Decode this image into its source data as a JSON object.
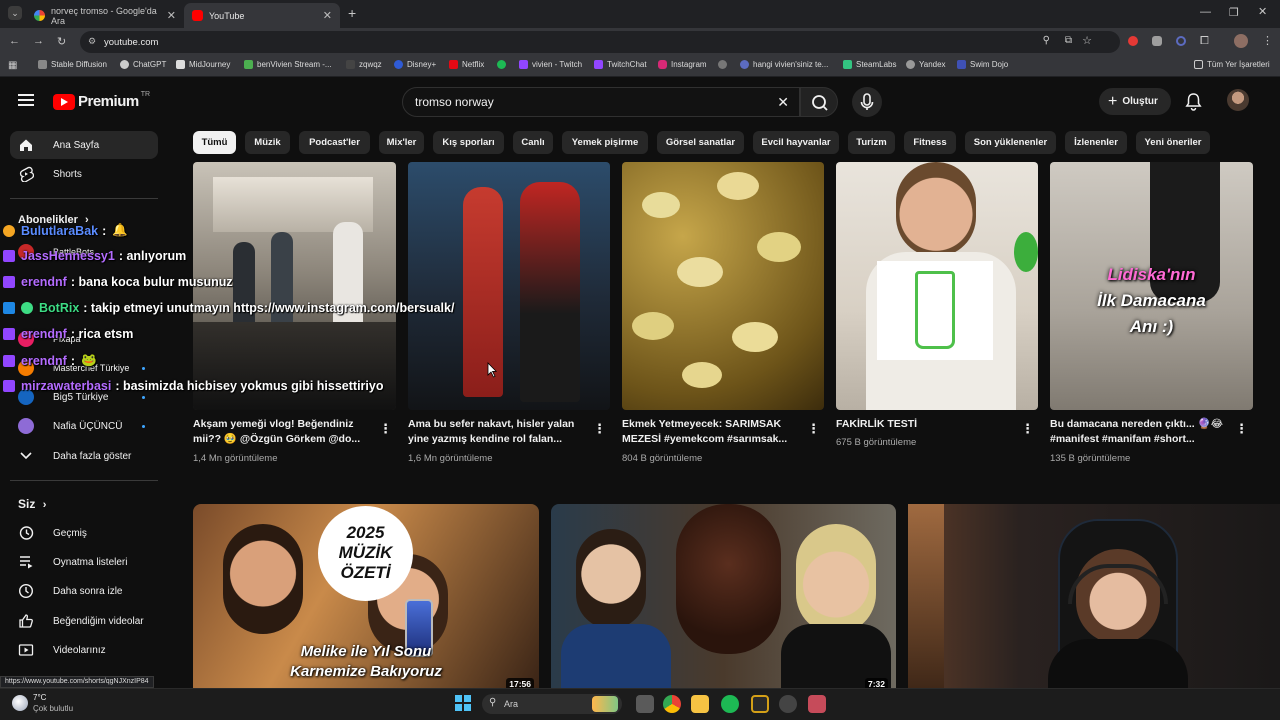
{
  "browser": {
    "tabs": [
      {
        "title": "norveç tromso - Google'da Ara"
      },
      {
        "title": "YouTube"
      }
    ],
    "new_tab": "+",
    "url": "youtube.com",
    "bookmarks": [
      "Stable Diffusion",
      "ChatGPT",
      "MidJourney",
      "benVivien Stream -...",
      "zqwqz",
      "Disney+",
      "Netflix",
      "vivien - Twitch",
      "TwitchChat",
      "Instagram",
      "hangi vivien'siniz te...",
      "SteamLabs",
      "Yandex",
      "Swim Dojo"
    ],
    "all_bookmarks": "Tüm Yer İşaretleri"
  },
  "youtube": {
    "logo": "Premium",
    "logo_region": "TR",
    "search_value": "tromso norway",
    "create_label": "Oluştur",
    "chips": [
      "Tümü",
      "Müzik",
      "Podcast'ler",
      "Mix'ler",
      "Kış sporları",
      "Canlı",
      "Yemek pişirme",
      "Görsel sanatlar",
      "Evcil hayvanlar",
      "Turizm",
      "Fitness",
      "Son yüklenenler",
      "İzlenenler",
      "Yeni öneriler"
    ],
    "sidebar": {
      "top": [
        {
          "label": "Ana Sayfa",
          "icon": "home-icon"
        },
        {
          "label": "Shorts",
          "icon": "shorts-icon"
        }
      ],
      "subscriptions_header": "Abonelikler",
      "subscriptions": [
        "BattleBots",
        "Pixapa",
        "Masterchef Türkiye",
        "Big5 Türkiye",
        "Nafia ÜÇÜNCÜ"
      ],
      "show_more": "Daha fazla göster",
      "you_header": "Siz",
      "you_items": [
        {
          "label": "Geçmiş",
          "icon": "history-icon"
        },
        {
          "label": "Oynatma listeleri",
          "icon": "playlist-icon"
        },
        {
          "label": "Daha sonra izle",
          "icon": "clock-icon"
        },
        {
          "label": "Beğendiğim videolar",
          "icon": "thumbs-up-icon"
        },
        {
          "label": "Videolarınız",
          "icon": "video-icon"
        }
      ]
    },
    "shorts": [
      {
        "title": "Akşam yemeği vlog! Beğendiniz mii?? 🥹 @Özgün Görkem @do...",
        "views": "1,4 Mn görüntüleme"
      },
      {
        "title": "Ama bu sefer nakavt, hisler yalan yine yazmış kendine rol falan...",
        "views": "1,6 Mn görüntüleme"
      },
      {
        "title": "Ekmek Yetmeyecek: SARIMSAK MEZESİ #yemekcom #sarımsak...",
        "views": "804 B görüntüleme"
      },
      {
        "title": "FAKİRLİK TESTİ",
        "views": "675 B görüntüleme"
      },
      {
        "title": "Bu damacana nereden çıktı... 🔮😂 #manifest #manifam #short...",
        "views": "135 B görüntüleme"
      }
    ],
    "short5_overlay": [
      "Lidiska'nın",
      "İlk Damacana",
      "Anı :)"
    ],
    "videos": [
      {
        "overlay_badge": [
          "2025",
          "MÜZİK",
          "ÖZETİ"
        ],
        "overlay_caption": [
          "Melike ile Yıl Sonu",
          "Karnemize Bakıyoruz"
        ],
        "duration": "17:56"
      },
      {
        "duration": "7:32"
      }
    ]
  },
  "chat": [
    {
      "user": "BulutlaraBak",
      "msg": ":",
      "user_color": "#5b8cff"
    },
    {
      "user": "JassHennessy1",
      "msg": ": anlıyorum",
      "user_color": "#b46cff"
    },
    {
      "user": "erendnf",
      "msg": ": bana koca bulur musunuz",
      "user_color": "#b46cff"
    },
    {
      "user": "BotRix",
      "msg": ": takip etmeyi unutmayın https://www.instagram.com/bersualk/",
      "user_color": "#3ddc84"
    },
    {
      "user": "erendnf",
      "msg": ": rica etsm",
      "user_color": "#b46cff"
    },
    {
      "user": "erendnf",
      "msg": ":",
      "user_color": "#b46cff"
    },
    {
      "user": "mirzawaterbasi",
      "msg": ": basimizda hicbisey yokmus gibi hissettiriyo",
      "user_color": "#b46cff"
    }
  ],
  "status_url": "https://www.youtube.com/shorts/qgNJXnzIP84",
  "taskbar": {
    "weather_temp": "7°C",
    "weather_desc": "Çok bulutlu",
    "search_label": "Ara"
  }
}
